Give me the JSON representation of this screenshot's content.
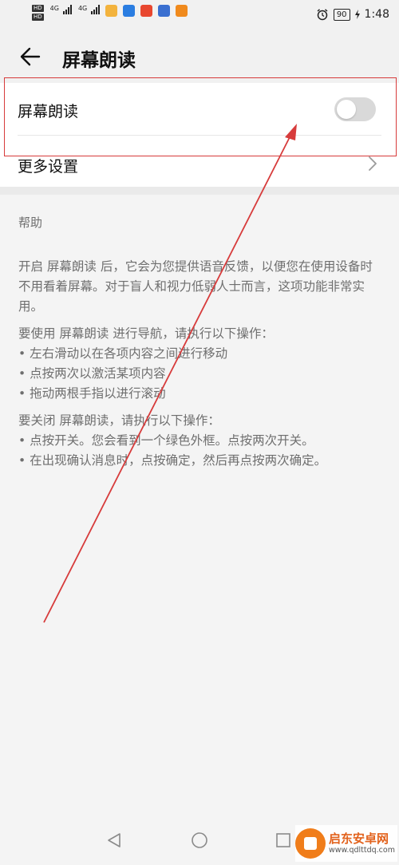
{
  "status_bar": {
    "hd1": "HD",
    "hd2": "HD",
    "net1": "4G",
    "net2": "4G",
    "battery": "90",
    "time": "1:48"
  },
  "header": {
    "title": "屏幕朗读"
  },
  "settings": {
    "screen_reader_label": "屏幕朗读",
    "screen_reader_enabled": false,
    "more_settings_label": "更多设置"
  },
  "help": {
    "heading": "帮助",
    "intro": "开启 屏幕朗读 后，它会为您提供语音反馈，以便您在使用设备时不用看着屏幕。对于盲人和视力低弱人士而言，这项功能非常实用。",
    "nav_title": "要使用 屏幕朗读 进行导航，请执行以下操作：",
    "nav_items": [
      "• 左右滑动以在各项内容之间进行移动",
      "• 点按两次以激活某项内容",
      "• 拖动两根手指以进行滚动"
    ],
    "off_title": "要关闭 屏幕朗读，请执行以下操作：",
    "off_items": [
      "• 点按开关。您会看到一个绿色外框。点按两次开关。",
      "• 在出现确认消息时，点按确定，然后再点按两次确定。"
    ]
  },
  "watermark": {
    "name": "启东安卓网",
    "url": "www.qdlttdq.com"
  },
  "icons": {
    "back": "back-arrow-icon",
    "chevron": "chevron-right-icon",
    "nav_back": "triangle-back-icon",
    "nav_home": "circle-home-icon",
    "nav_recent": "square-recent-icon"
  },
  "colors": {
    "annotation": "#d73b3b",
    "toggle_off": "#d9d9d9",
    "watermark": "#f07d1a"
  }
}
